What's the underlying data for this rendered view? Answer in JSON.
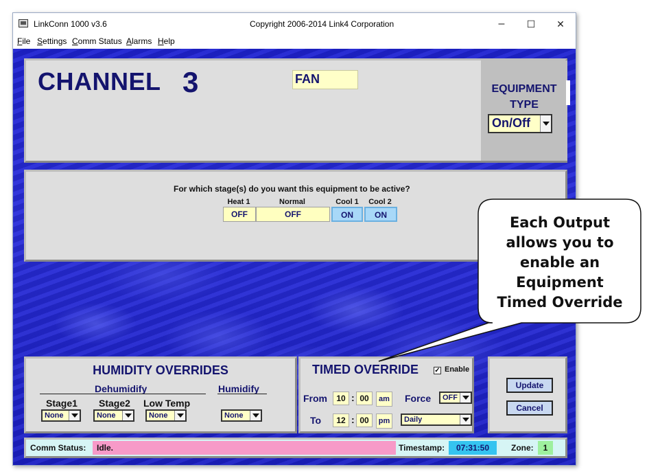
{
  "window": {
    "app_title": "LinkConn 1000 v3.6",
    "copyright": "Copyright 2006-2014 Link4 Corporation",
    "minimize": "–",
    "maximize": "☐",
    "close": "✕"
  },
  "menu": [
    "File",
    "Settings",
    "Comm Status",
    "Alarms",
    "Help"
  ],
  "channel": {
    "label": "CHANNEL",
    "number": "3",
    "name": "FAN",
    "equipment_type_title": [
      "EQUIPMENT",
      "TYPE"
    ],
    "equipment_type_value": "On/Off"
  },
  "stages": {
    "question": "For which stage(s) do you want this equipment to be active?",
    "items": [
      {
        "head": "Heat 1",
        "value": "OFF"
      },
      {
        "head": "Normal",
        "value": "OFF"
      },
      {
        "head": "Cool 1",
        "value": "ON"
      },
      {
        "head": "Cool 2",
        "value": "ON"
      }
    ]
  },
  "humidity": {
    "title": "HUMIDITY OVERRIDES",
    "dehumidify": "Dehumidify",
    "humidify": "Humidify",
    "labels": [
      "Stage1",
      "Stage2",
      "Low Temp"
    ],
    "values": [
      "None",
      "None",
      "None",
      "None"
    ]
  },
  "timed_override": {
    "title": "TIMED OVERRIDE",
    "enable_checked": "✓",
    "enable_label": "Enable",
    "from_label": "From",
    "to_label": "To",
    "from_hour": "10",
    "from_min": "00",
    "from_ampm": "am",
    "to_hour": "12",
    "to_min": "00",
    "to_ampm": "pm",
    "colon": ":",
    "force_label": "Force",
    "force_value": "OFF",
    "schedule_value": "Daily"
  },
  "actions": {
    "update": "Update",
    "cancel": "Cancel"
  },
  "status": {
    "comm_label": "Comm Status:",
    "comm_value": "Idle.",
    "timestamp_label": "Timestamp:",
    "timestamp_value": "07:31:50",
    "zone_label": "Zone:",
    "zone_value": "1"
  },
  "callout": {
    "lines": [
      "Each Output",
      "allows you to",
      "enable an",
      "Equipment",
      "Timed Override"
    ]
  }
}
